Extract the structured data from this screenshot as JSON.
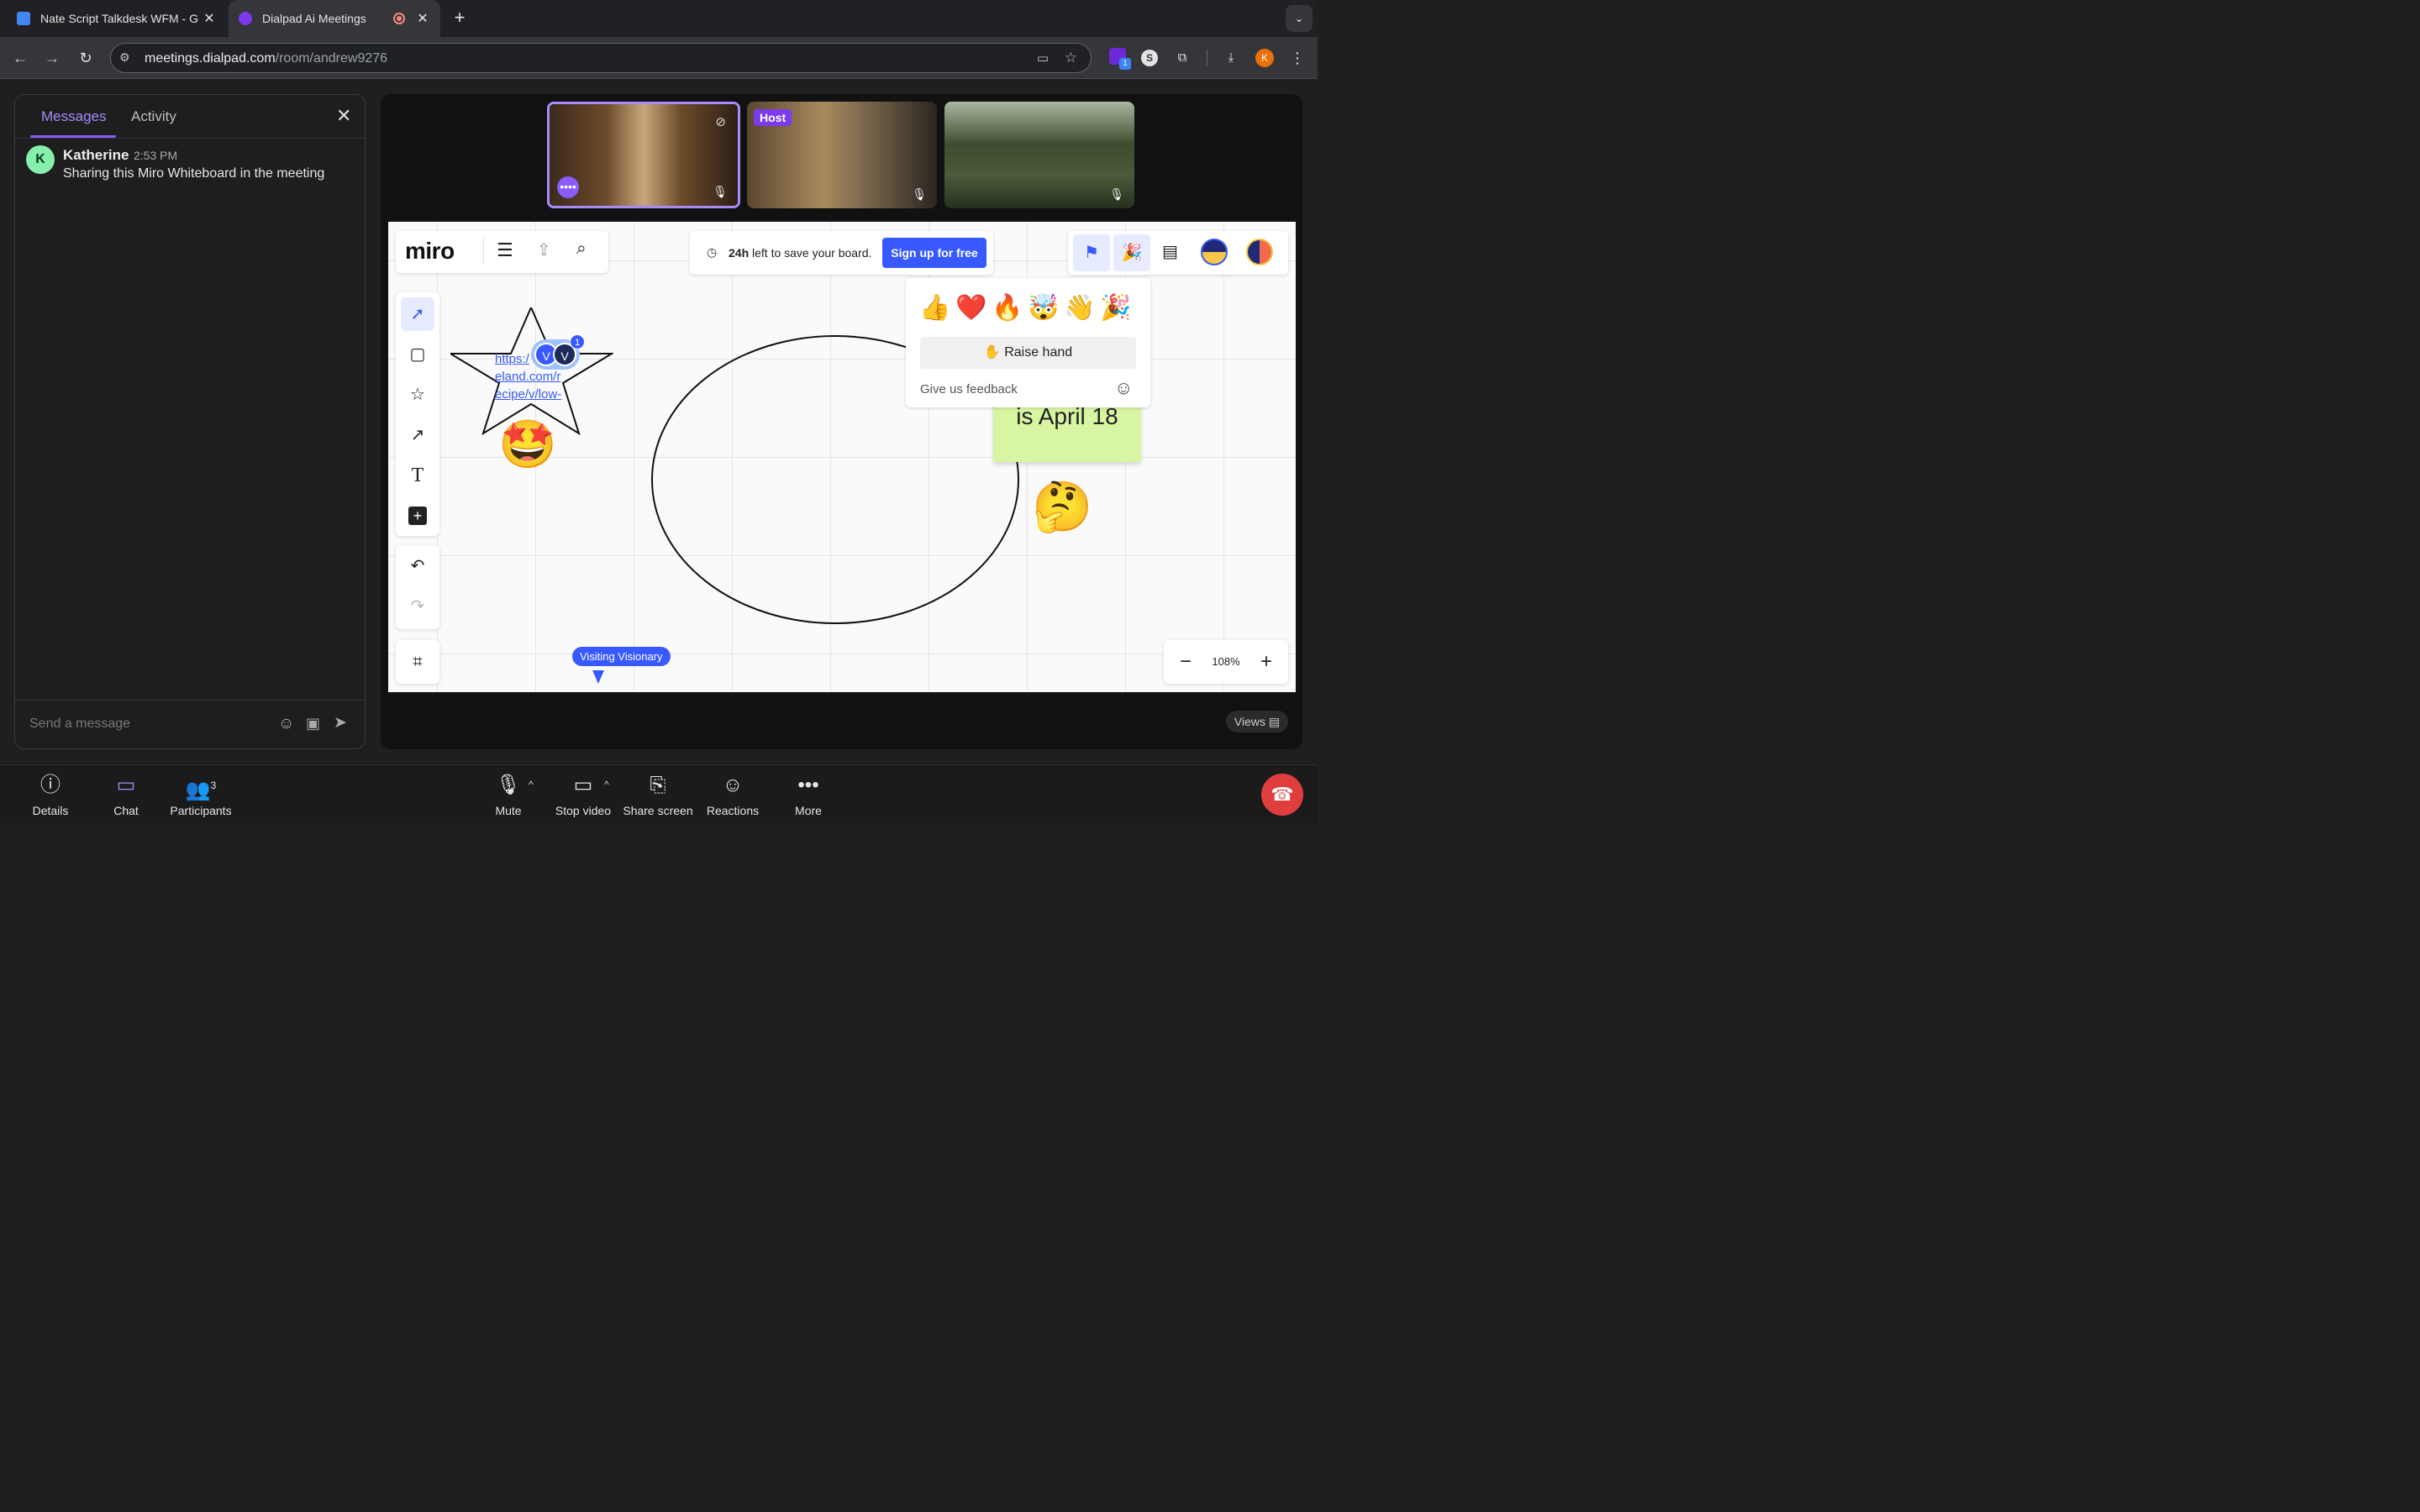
{
  "browser": {
    "tabs": [
      {
        "title": "Nate Script Talkdesk WFM - G"
      },
      {
        "title": "Dialpad Ai Meetings"
      }
    ],
    "url_host": "meetings.dialpad.com",
    "url_path": "/room/andrew9276",
    "extension_badge": "1",
    "profile_initial": "K"
  },
  "chat": {
    "tabs": [
      "Messages",
      "Activity"
    ],
    "messages": [
      {
        "initial": "K",
        "name": "Katherine",
        "time": "2:53 PM",
        "text": "Sharing this Miro Whiteboard in the meeting"
      }
    ],
    "input_placeholder": "Send a message"
  },
  "videos": {
    "host_label": "Host"
  },
  "miro": {
    "logo": "miro",
    "save_notice_bold": "24h",
    "save_notice_rest": "left to save your board.",
    "signup_label": "Sign up for free",
    "reactions_panel": {
      "raise_hand_label": "Raise hand",
      "feedback_label": "Give us feedback"
    },
    "board": {
      "link_text_lines": [
        "https:/",
        "eland.com/r",
        "ecipe/v/low-"
      ],
      "cursor_avatars": [
        "V",
        "V"
      ],
      "cursor_badge": "1",
      "sticky_text": "is April 18",
      "visitor_label": "Visiting Visionary"
    },
    "zoom_level": "108%",
    "views_label": "Views"
  },
  "bottombar": {
    "items": [
      {
        "label": "Details"
      },
      {
        "label": "Chat"
      },
      {
        "label": "Participants",
        "badge": "3"
      },
      {
        "label": "Mute"
      },
      {
        "label": "Stop video"
      },
      {
        "label": "Share screen"
      },
      {
        "label": "Reactions"
      },
      {
        "label": "More"
      }
    ]
  },
  "colors": {
    "accent": "#8b5cf6",
    "miro_blue": "#3859ff",
    "sticky": "#d8f5a2",
    "hangup": "#e03e3e"
  }
}
